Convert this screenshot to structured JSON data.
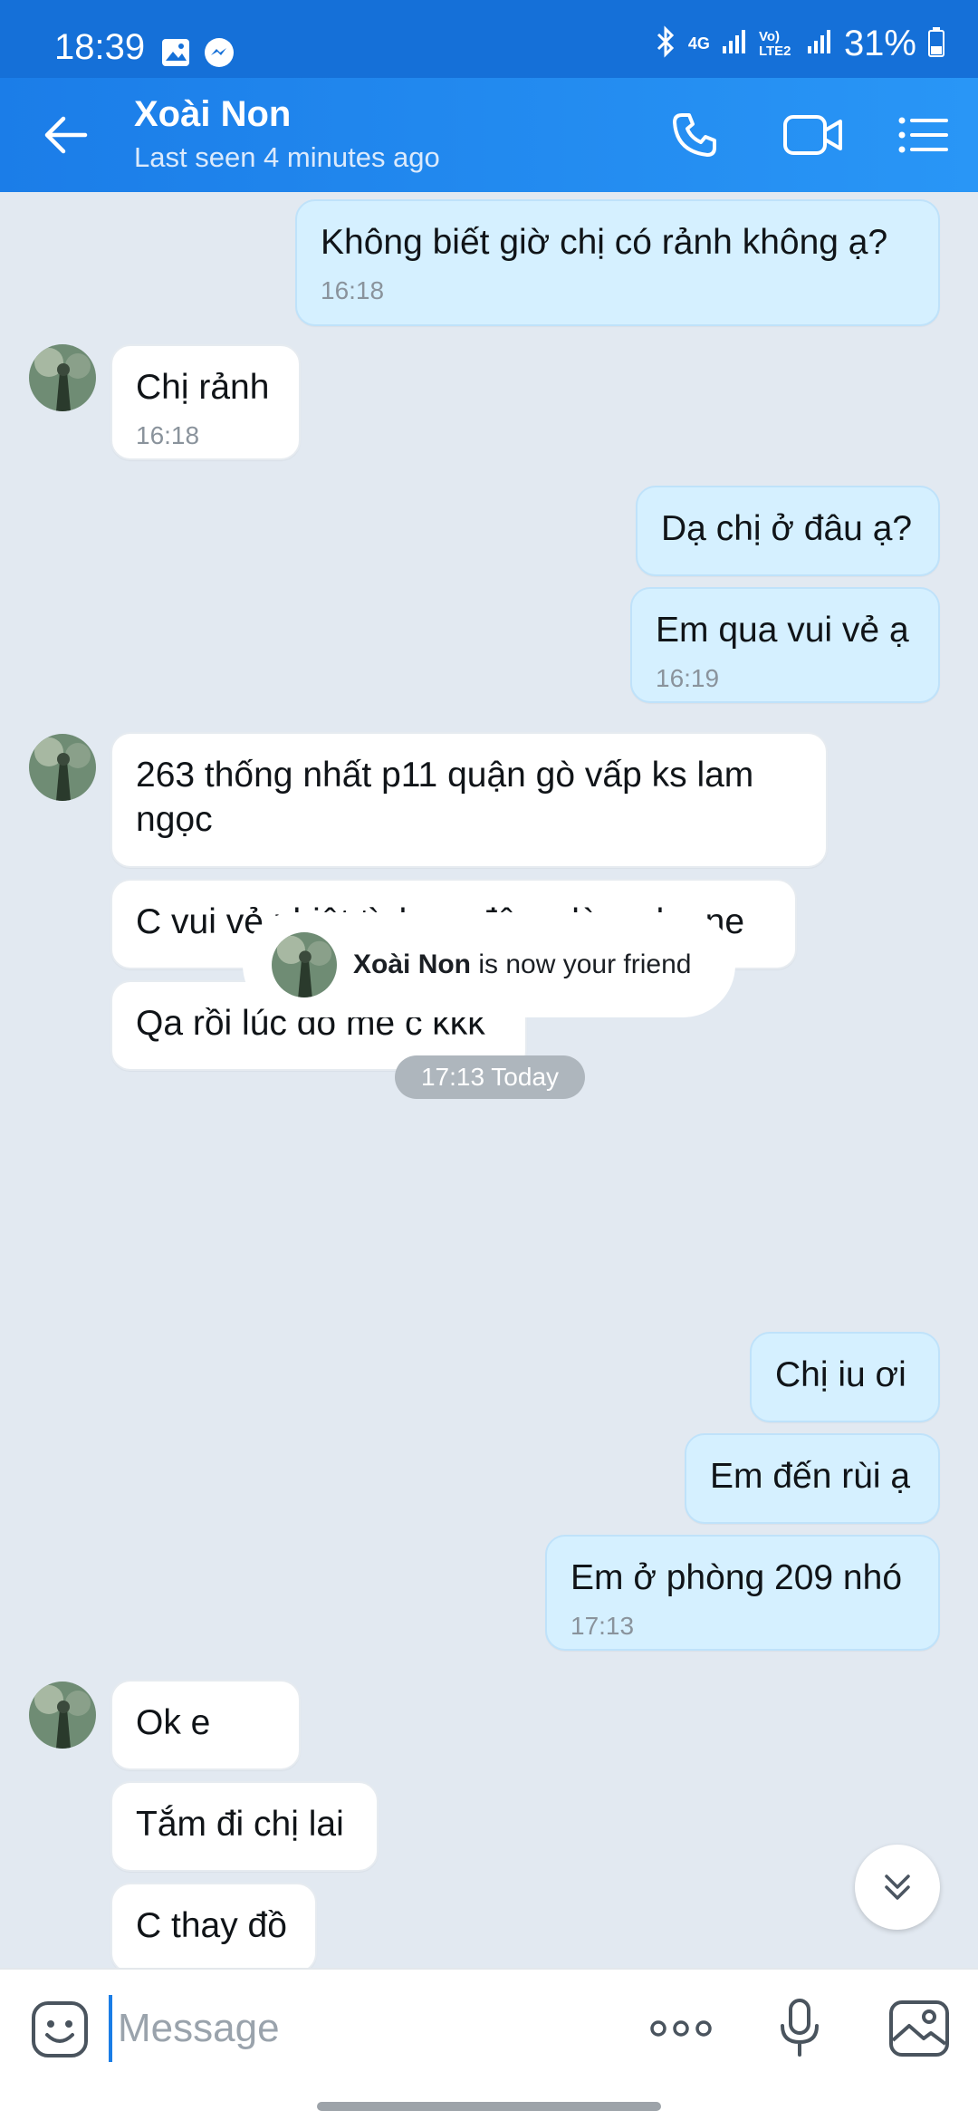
{
  "status_bar": {
    "time": "18:39",
    "network": "4G",
    "volte": "Vo) LTE2",
    "battery": "31%"
  },
  "header": {
    "contact_name": "Xoài Non",
    "last_seen": "Last seen 4 minutes ago"
  },
  "messages": [
    {
      "dir": "out",
      "text": "Không biết giờ chị có rảnh không ạ?",
      "time": "16:18"
    },
    {
      "dir": "in",
      "text": "Chị rảnh",
      "time": "16:18"
    },
    {
      "dir": "out",
      "text": "Dạ chị ở đâu ạ?"
    },
    {
      "dir": "out",
      "text": "Em qua vui vẻ ạ",
      "time": "16:19"
    },
    {
      "dir": "in",
      "text": "263 thống nhất p11 quận gò vấp ks lam ngọc"
    },
    {
      "dir": "in",
      "text": "C vui vẻ nhiệt tình qa đây c làm cho ne"
    },
    {
      "dir": "in",
      "text": "Qa rồi lúc đó mê c kkk"
    },
    {
      "dir": "out",
      "text": "Chị iu ơi"
    },
    {
      "dir": "out",
      "text": "Em đến rùi ạ"
    },
    {
      "dir": "out",
      "text": "Em ở phòng 209 nhó",
      "time": "17:13"
    },
    {
      "dir": "in",
      "text": "Ok e"
    },
    {
      "dir": "in",
      "text": "Tắm đi chị lai"
    },
    {
      "dir": "in",
      "text": "C thay đồ"
    }
  ],
  "friend_notice": {
    "name": "Xoài Non",
    "text": " is now your friend"
  },
  "date_chip": "17:13 Today",
  "input": {
    "placeholder": "Message"
  },
  "colors": {
    "header": "#1b7de8",
    "outgoing_bubble": "#d5f0ff",
    "incoming_bubble": "#ffffff",
    "chat_background": "#e2e9f1"
  }
}
